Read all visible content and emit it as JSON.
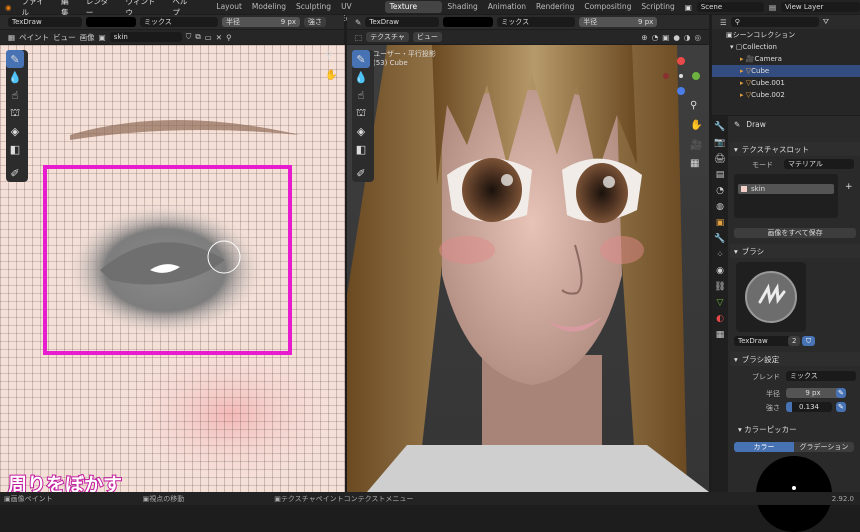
{
  "menu": {
    "items": [
      "ファイル",
      "編集",
      "レンダー",
      "ウィンドウ",
      "ヘルプ"
    ]
  },
  "workspaces": [
    "Layout",
    "Modeling",
    "Sculpting",
    "UV Editing",
    "Texture Paint",
    "Shading",
    "Animation",
    "Rendering",
    "Compositing",
    "Scripting"
  ],
  "active_workspace": "Texture Paint",
  "scene": {
    "name": "Scene",
    "view_layer": "View Layer"
  },
  "left_editor": {
    "brush": "TexDraw",
    "blend": "ミックス",
    "radius_label": "半径",
    "radius_value": "9 px",
    "strength_short": "強さ",
    "menu_paint": "ペイント",
    "menu_view": "ビュー",
    "menu_image": "画像",
    "image_name": "skin"
  },
  "right_editor": {
    "mode": "テクスチャ",
    "view_menu": "ビュー",
    "brush": "TexDraw",
    "blend": "ミックス",
    "radius_label": "半径",
    "radius_value": "9 px",
    "overlay_title": "ユーザー・平行投影",
    "overlay_sub": "(53) Cube"
  },
  "outliner": {
    "title": "シーンコレクション",
    "items": [
      {
        "name": "Collection",
        "selected": false
      },
      {
        "name": "Camera",
        "selected": false
      },
      {
        "name": "Cube",
        "selected": true
      },
      {
        "name": "Cube.001",
        "selected": false
      },
      {
        "name": "Cube.002",
        "selected": false
      }
    ]
  },
  "properties": {
    "tool_name": "Draw",
    "texture_slots_header": "テクスチャスロット",
    "mode_label": "モード",
    "mode_value": "マテリアル",
    "slot_name": "skin",
    "save_all": "画像をすべて保存",
    "brush_header": "ブラシ",
    "brush_name": "TexDraw",
    "brush_users": "2",
    "brush_settings_header": "ブラシ設定",
    "blend_label": "ブレンド",
    "blend_value": "ミックス",
    "radius_label": "半径",
    "radius_value": "9 px",
    "strength_label": "強さ",
    "strength_value": "0.134",
    "strength_fraction": 0.134,
    "color_picker_header": "カラーピッカー",
    "color_tab": "カラー",
    "gradient_tab": "グラデーション"
  },
  "caption": "周りをぼかす",
  "status": {
    "left": "画像ペイント",
    "mid": "視点の移動",
    "context": "テクスチャペイントコンテクストメニュー",
    "version": "2.92.0"
  },
  "colors": {
    "accent": "#4772b3",
    "highlight_box": "#e81ccf",
    "caption_fill": "#ffffff",
    "caption_stroke": "#c2189e"
  }
}
